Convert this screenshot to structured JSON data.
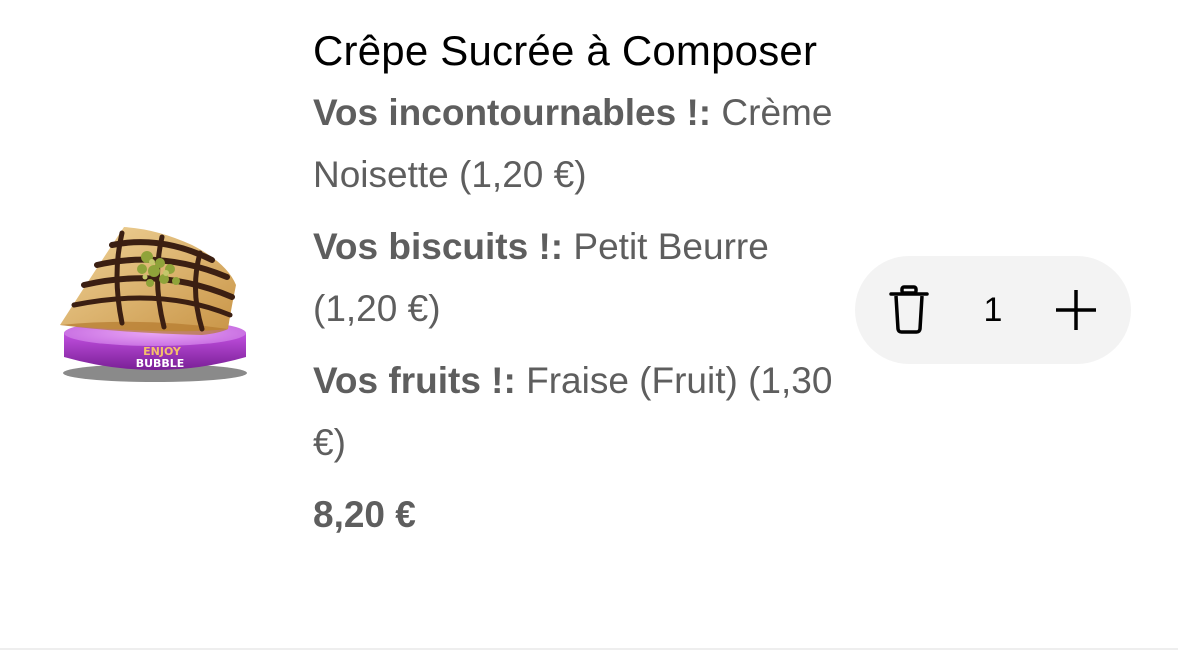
{
  "item": {
    "title": "Crêpe Sucrée à Composer",
    "options": [
      {
        "label": "Vos incontournables !:",
        "value": "Crème Noisette (1,20 €)"
      },
      {
        "label": "Vos biscuits !:",
        "value": "Petit Beurre (1,20 €)"
      },
      {
        "label": "Vos fruits !:",
        "value": "Fraise (Fruit) (1,30 €)"
      }
    ],
    "price": "8,20 €",
    "image": {
      "brand_text_line1": "ENJOY",
      "brand_text_line2": "BUBBLE"
    }
  },
  "stepper": {
    "quantity": "1",
    "delete_icon": "trash-icon",
    "increment_icon": "plus-icon"
  },
  "colors": {
    "title": "#000000",
    "secondary_text": "#5e5e5e",
    "stepper_background": "#f3f3f3",
    "divider": "#eeeeee",
    "plate_purple": "#b63fd6"
  }
}
